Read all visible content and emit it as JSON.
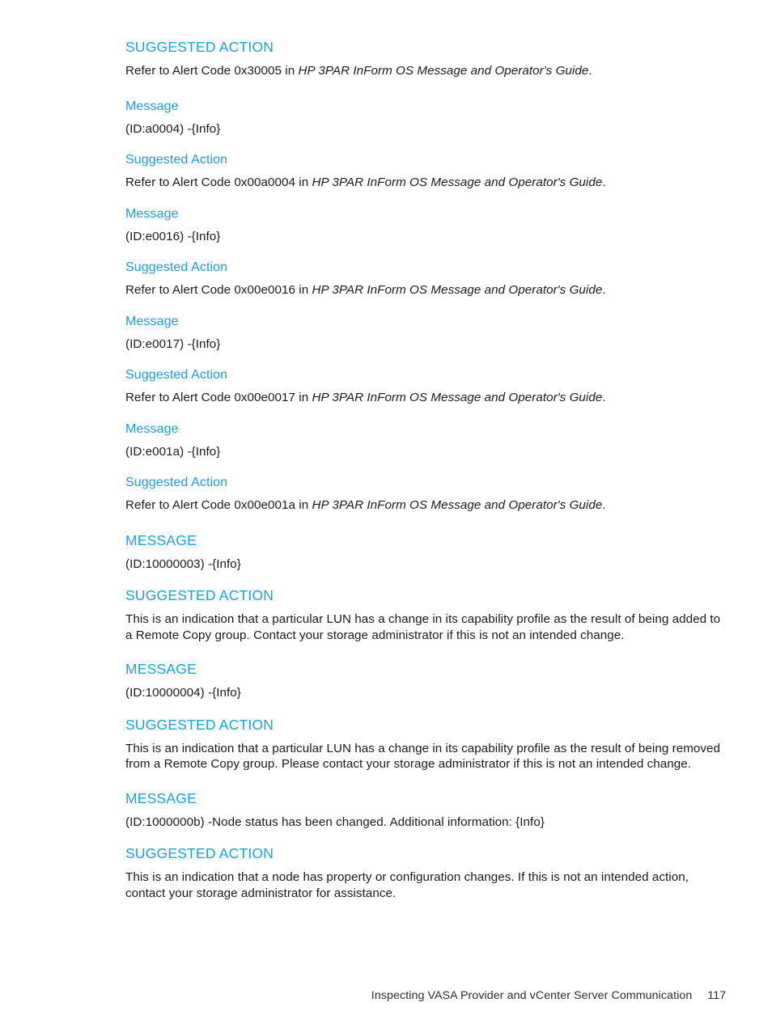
{
  "page": {
    "background_color": "#ffffff",
    "heading_color": "#16A3DC",
    "body_color": "#1a1a1a"
  },
  "sections": {
    "s0": {
      "heading": "SUGGESTED ACTION",
      "body_prefix": "Refer to Alert Code 0x30005 in ",
      "body_italic": "HP 3PAR InForm OS Message and Operator's Guide",
      "body_suffix": "."
    },
    "s1": {
      "heading": "Message",
      "body": "(ID:a0004) -{Info}"
    },
    "s2": {
      "heading": "Suggested Action",
      "body_prefix": "Refer to Alert Code 0x00a0004 in ",
      "body_italic": "HP 3PAR InForm OS Message and Operator's Guide",
      "body_suffix": "."
    },
    "s3": {
      "heading": "Message",
      "body": "(ID:e0016) -{Info}"
    },
    "s4": {
      "heading": "Suggested Action",
      "body_prefix": "Refer to Alert Code 0x00e0016 in ",
      "body_italic": "HP 3PAR InForm OS Message and Operator's Guide",
      "body_suffix": "."
    },
    "s5": {
      "heading": "Message",
      "body": "(ID:e0017) -{Info}"
    },
    "s6": {
      "heading": "Suggested Action",
      "body_prefix": "Refer to Alert Code 0x00e0017 in ",
      "body_italic": "HP 3PAR InForm OS Message and Operator's Guide",
      "body_suffix": "."
    },
    "s7": {
      "heading": "Message",
      "body": "(ID:e001a) -{Info}"
    },
    "s8": {
      "heading": "Suggested Action",
      "body_prefix": "Refer to Alert Code 0x00e001a in ",
      "body_italic": "HP 3PAR InForm OS Message and Operator's Guide",
      "body_suffix": "."
    },
    "s9": {
      "heading": "MESSAGE",
      "body": "(ID:10000003) -{Info}"
    },
    "s10": {
      "heading": "SUGGESTED ACTION",
      "body": "This is an indication that a particular LUN has a change in its capability profile as the result of being added to a Remote Copy group. Contact your storage administrator if this is not an intended change."
    },
    "s11": {
      "heading": "MESSAGE",
      "body": "(ID:10000004) -{Info}"
    },
    "s12": {
      "heading": "SUGGESTED ACTION",
      "body": "This is an indication that a particular LUN has a change in its capability profile as the result of being removed from a Remote Copy group. Please contact your storage administrator if this is not an intended change."
    },
    "s13": {
      "heading": "MESSAGE",
      "body": "(ID:1000000b) -Node status has been changed. Additional information: {Info}"
    },
    "s14": {
      "heading": "SUGGESTED ACTION",
      "body": "This is an indication that a node has property or configuration changes. If this is not an intended action, contact your storage administrator for assistance."
    }
  },
  "footer": {
    "chapter_title": "Inspecting VASA Provider and vCenter Server Communication",
    "page_number": "117"
  }
}
